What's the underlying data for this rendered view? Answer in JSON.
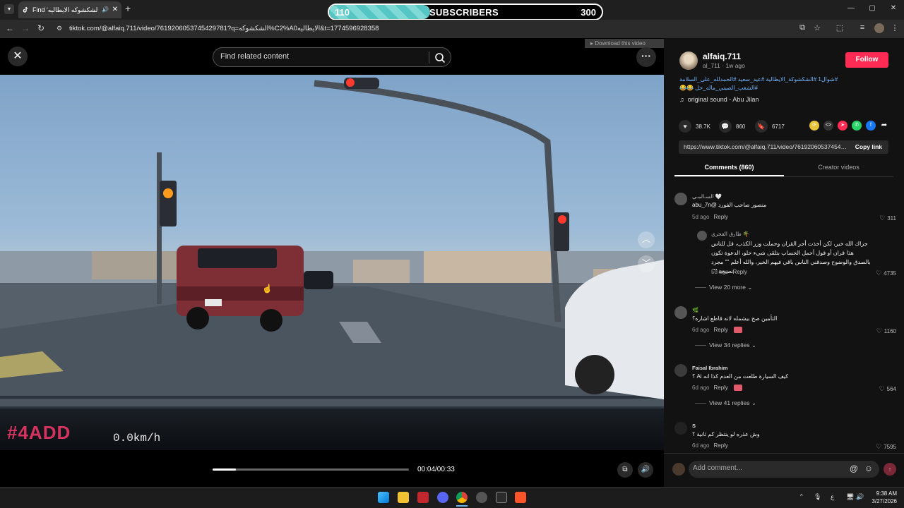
{
  "browser": {
    "tab_title": "Find 'الشكشوكه الايطاليه' on",
    "new_tab": "+",
    "url": "tiktok.com/@alfaiq.711/video/7619206053745429781?q=الشكشوكه%C2%A0الايطاليه&t=1774596928358",
    "window_controls": [
      "—",
      "▢",
      "✕"
    ]
  },
  "overlay": {
    "sub_count": "110",
    "sub_label": "SUBSCRIBERS",
    "sub_goal": "300",
    "sub_progress": 0.37
  },
  "video_page": {
    "search_placeholder": "Find related content",
    "download_label": "Download this video",
    "watermark": "#4ADD",
    "speed_text": "0.0km/h",
    "time": "00:04/00:33",
    "progress": 0.12
  },
  "author": {
    "username": "alfaiq.711",
    "handle": "al_711",
    "posted": "1w ago",
    "follow_label": "Follow",
    "description": "#شوال1 #الشكشوكة_الايطالية #عيد_سعيد #الحمدلله_على_السلامة #الشعب_الصيني_ماله_حل 😂😂",
    "sound": "original sound - Abu Jilan"
  },
  "stats": {
    "likes": "38.7K",
    "comments": "860",
    "saves": "6717"
  },
  "share": {
    "link": "https://www.tiktok.com/@alfaiq.711/video/7619206053745429781",
    "copy_label": "Copy link"
  },
  "tabs": {
    "comments": "Comments (860)",
    "creator": "Creator videos"
  },
  "comments": [
    {
      "user": "السـالمـي 🤍",
      "text_line1": "منصور صاحب الفورد @abu_7n",
      "age": "5d ago",
      "reply": "Reply",
      "likes": "311"
    },
    {
      "user": "طارق القحري 🌴",
      "text": "جزاك الله خير، لكن أخذت أجر القران وحملت وزر الكذب، قل للناس هذا قران أو قول أحمل الحساب بتلقى شيء حلو، الدعوة تكون بالصدق والوضوح وصدقني الناس باقي فيهم الخير، والله أعلم \"\" مجرد نصيحة \"\".",
      "age": "5d ago",
      "reply": "Reply",
      "likes": "4735"
    },
    {
      "view_more": "View 20 more"
    },
    {
      "user": "🌿",
      "text": "التأمين صح بيشمله لانه قاطع اشاره؟",
      "age": "6d ago",
      "reply": "Reply",
      "likes": "1160",
      "view_more": "View 34 replies"
    },
    {
      "user": "Faisal Ibrahim",
      "text": "كيف السيارة طلعت من العدم كذا انه Ai ؟",
      "age": "6d ago",
      "reply": "Reply",
      "likes": "564",
      "view_more": "View 41 replies"
    },
    {
      "user": "S",
      "text": "وش عذره لو ينتظر كم ثانية ؟",
      "age": "6d ago",
      "reply": "Reply",
      "likes": "7595"
    }
  ],
  "comment_box": {
    "placeholder": "Add comment..."
  },
  "taskbar": {
    "time": "9:38 AM",
    "date": "3/27/2026",
    "lang": "ع"
  }
}
